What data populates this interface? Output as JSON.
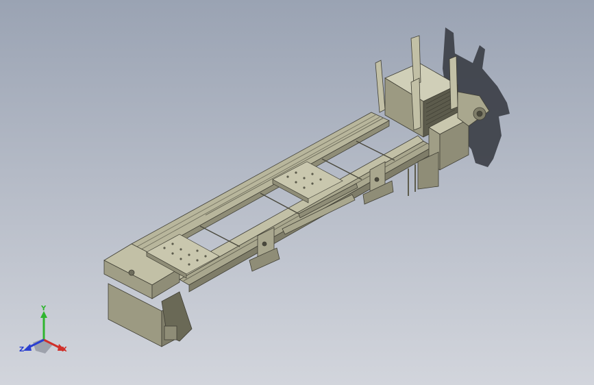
{
  "viewport": {
    "background_top": "#9aa3b3",
    "background_bottom": "#d2d5dc"
  },
  "model": {
    "body_color": "#b7b59b",
    "shade_color": "#8f8d77",
    "dark_color": "#5c5b4c",
    "shadow_color": "#3a3d45"
  },
  "triad": {
    "x_label": "X",
    "y_label": "Y",
    "z_label": "Z",
    "x_color": "#d0302a",
    "y_color": "#2fb52f",
    "z_color": "#2a3fd0"
  }
}
